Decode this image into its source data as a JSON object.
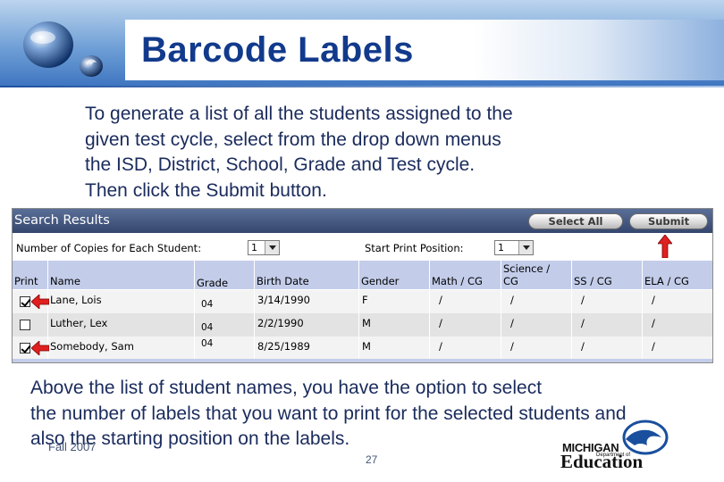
{
  "slide": {
    "title": "Barcode Labels",
    "intro_lines": [
      "To generate a list of all the students assigned to the",
      "given test cycle, select from the drop down menus",
      "the ISD, District, School, Grade and Test cycle.",
      "Then click the Submit button."
    ],
    "outro_lines": [
      "Above the list of student names, you have the option to select",
      "the number of labels that you want to print for the selected students and",
      "also the starting position on the labels."
    ],
    "footer_date": "Fall 2007",
    "page_number": "27",
    "logo_text": {
      "line1": "MICHIGAN",
      "line2": "Department of",
      "line3": "Education"
    }
  },
  "panel": {
    "title": "Search Results",
    "select_all_label": "Select All",
    "submit_label": "Submit",
    "copies_label": "Number of Copies for Each Student:",
    "copies_value": "1",
    "start_position_label": "Start Print Position:",
    "start_position_value": "1"
  },
  "table": {
    "headers": {
      "print": "Print",
      "name": "Name",
      "grade": "Grade",
      "birth_date": "Birth Date",
      "gender": "Gender",
      "math": "Math / CG",
      "science_line1": "Science /",
      "science_line2": "CG",
      "ss": "SS / CG",
      "ela": "ELA / CG"
    },
    "rows": [
      {
        "checked": true,
        "name": "Lane, Lois",
        "grade": "04",
        "birth_date": "3/14/1990",
        "gender": "F",
        "math": "/",
        "science": "/",
        "ss": "/",
        "ela": "/"
      },
      {
        "checked": false,
        "name": "Luther, Lex",
        "grade": "04",
        "birth_date": "2/2/1990",
        "gender": "M",
        "math": "/",
        "science": "/",
        "ss": "/",
        "ela": "/"
      },
      {
        "checked": true,
        "name": "Somebody, Sam",
        "grade": "04",
        "birth_date": "8/25/1989",
        "gender": "M",
        "math": "/",
        "science": "/",
        "ss": "/",
        "ela": "/"
      }
    ]
  },
  "colors": {
    "title_blue": "#123a8c",
    "text_navy": "#1a2b5c",
    "header_bar": "#34466d",
    "table_header": "#c3cdea",
    "arrow_red": "#e02020"
  },
  "icons": [
    "globe-logo-icon",
    "red-up-arrow-icon",
    "red-left-arrow-icon",
    "michigan-map-icon"
  ]
}
